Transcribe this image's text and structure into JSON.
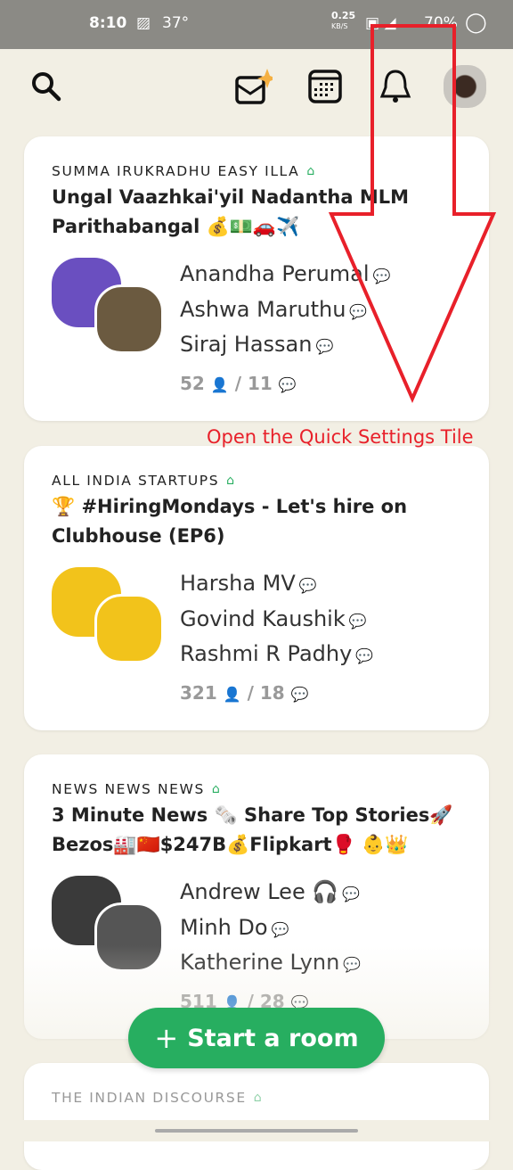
{
  "status": {
    "time": "8:10",
    "temp": "37°",
    "speed": "0.25",
    "speed_unit": "KB/S",
    "battery": "70%"
  },
  "header": {
    "icons": [
      "search-icon",
      "invite-envelope-icon",
      "calendar-icon",
      "bell-icon",
      "avatar"
    ]
  },
  "rooms": [
    {
      "club": "SUMMA IRUKRADHU EASY ILLA",
      "title": "Ungal Vaazhkai'yil Nadantha MLM Parithabangal 💰💵🚗✈️",
      "speakers": [
        "Anandha Perumal",
        "Ashwa Maruthu",
        "Siraj Hassan"
      ],
      "listeners": "52",
      "speakers_count": "11",
      "colors": [
        "#6a4fc0",
        "#6b5a40"
      ]
    },
    {
      "club": "ALL INDIA STARTUPS",
      "title": "🏆 #HiringMondays - Let's hire on Clubhouse (EP6)",
      "speakers": [
        "Harsha MV",
        "Govind Kaushik",
        "Rashmi R Padhy"
      ],
      "listeners": "321",
      "speakers_count": "18",
      "colors": [
        "#f2c31b",
        "#f2c31b"
      ]
    },
    {
      "club": "NEWS NEWS NEWS",
      "title": "3 Minute News 🗞️ Share Top Stories🚀 Bezos🏭🇨🇳$247B💰Flipkart🥊 👶👑",
      "speakers": [
        "Andrew Lee 🎧",
        "Minh Do",
        "Katherine Lynn"
      ],
      "listeners": "511",
      "speakers_count": "28",
      "colors": [
        "#3a3a3a",
        "#555"
      ]
    },
    {
      "club": "THE INDIAN DISCOURSE"
    }
  ],
  "start_room": "Start a room",
  "annotation": "Open the Quick Settings Tile",
  "accent": "#27ae60",
  "annotation_color": "#e8202a"
}
